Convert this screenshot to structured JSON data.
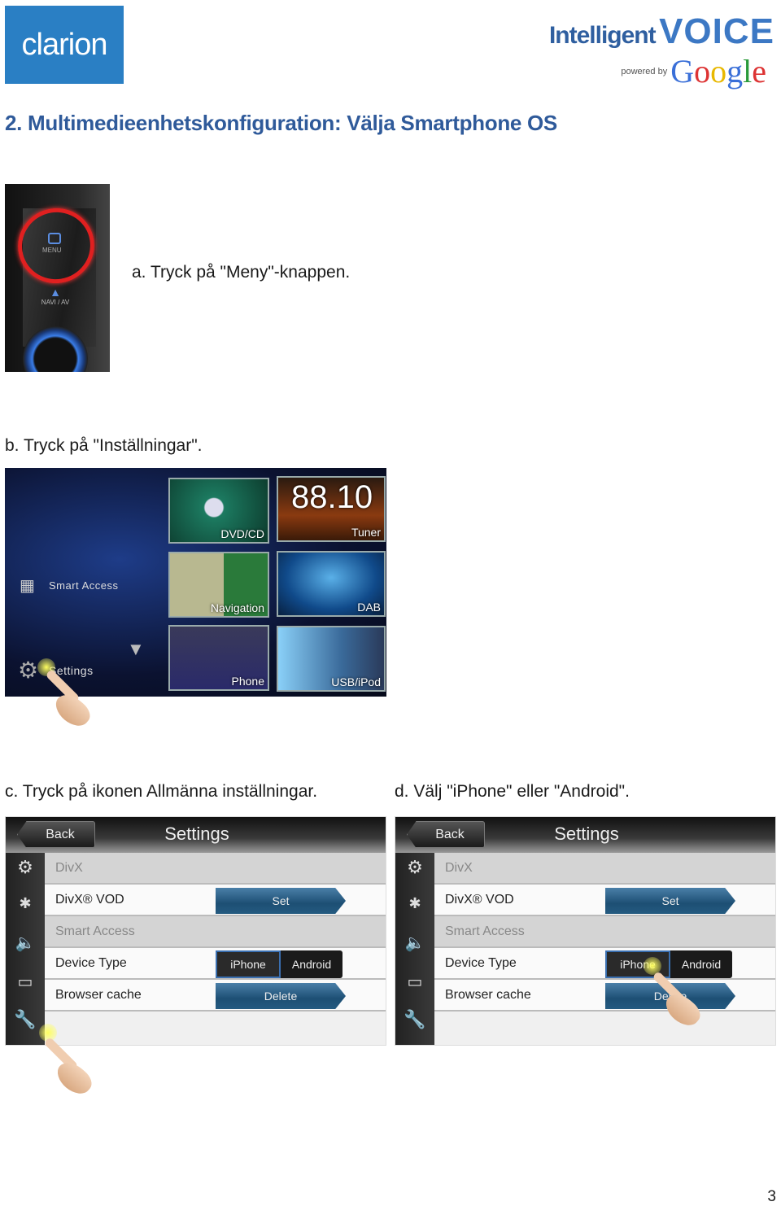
{
  "header": {
    "brand_logo": "clarion",
    "partner_logo": {
      "line1a": "Intelligent",
      "line1b": "VOICE",
      "powered_by": "powered by",
      "google": "Google"
    }
  },
  "title": "2. Multimedieenhetskonfiguration: Välja Smartphone OS",
  "steps": {
    "a": {
      "caption": "a. Tryck på \"Meny\"-knappen.",
      "device": {
        "menu_label": "MENU",
        "navi_label": "NAVI / AV"
      }
    },
    "b": {
      "caption": "b. Tryck på \"Inställningar\".",
      "screen": {
        "side_items": [
          "Smart Access",
          "Settings"
        ],
        "tiles": [
          "DVD/CD",
          "Tuner",
          "Navigation",
          "DAB",
          "Phone",
          "USB/iPod"
        ],
        "frequency": "88.10"
      }
    },
    "c": {
      "caption": "c. Tryck på ikonen Allmänna inställningar."
    },
    "d": {
      "caption": "d. Välj \"iPhone\" eller \"Android\"."
    }
  },
  "settings_screen": {
    "back": "Back",
    "title": "Settings",
    "side_icons": [
      "gear-icon",
      "bluetooth-icon",
      "speaker-icon",
      "display-icon",
      "wrench-icon"
    ],
    "rows": [
      {
        "type": "section",
        "label": "DivX"
      },
      {
        "type": "item",
        "label": "DivX® VOD",
        "button": "Set"
      },
      {
        "type": "section",
        "label": "Smart Access"
      },
      {
        "type": "item",
        "label": "Device Type",
        "options": [
          "iPhone",
          "Android"
        ],
        "selected": "iPhone"
      },
      {
        "type": "item",
        "label": "Browser cache",
        "button": "Delete"
      }
    ]
  },
  "page_number": "3",
  "colors": {
    "title": "#2f5a9a",
    "brand": "#2a7fc4",
    "button": "#1d4f74"
  }
}
